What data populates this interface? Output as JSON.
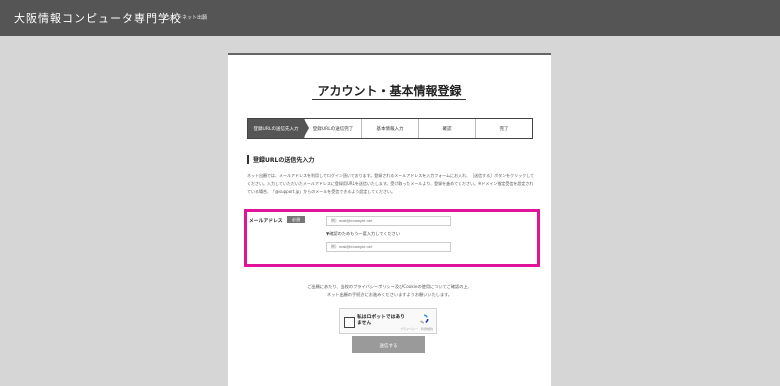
{
  "header": {
    "brand": "大阪情報コンピュータ専門学校",
    "subtitle": "インターネット出願"
  },
  "page": {
    "title": "アカウント・基本情報登録"
  },
  "steps": [
    {
      "label": "登録URLの送信先入力",
      "active": true
    },
    {
      "label": "登録URLの送信完了",
      "active": false
    },
    {
      "label": "基本情報入力",
      "active": false
    },
    {
      "label": "確認",
      "active": false
    },
    {
      "label": "完了",
      "active": false
    }
  ],
  "section": {
    "heading": "登録URLの送信先入力",
    "description": "ネット出願では、メールアドレスを利用してログイン頂いております。登録されるメールアドレスを入力フォームにお入れ、［送信する］ボタンをクリックしてください。入力していただいたメールアドレスに登録用URLを送信いたします。受け取ったメールより、登録を進めてください。※ドメイン指定受信を設定されている場合、「@support.jp」からのメールを受信できるよう設定してください。"
  },
  "form": {
    "email_label": "メールアドレス",
    "required": "必須",
    "email_placeholder": "例）mail@example.net",
    "confirm_note": "▼確認のためもう一度入力してください",
    "confirm_placeholder": "例）mail@example.net"
  },
  "privacy": {
    "line1": "ご出願にあたり、当校のプライバシーポリシー及びCookieの使用についてご確認の上、",
    "line2": "ネット出願の手続きにお進みくださいますようお願いいたします。"
  },
  "captcha": {
    "label": "私はロボットではありません",
    "footer": "プライバシー - 利用規約"
  },
  "submit_label": "送信する"
}
